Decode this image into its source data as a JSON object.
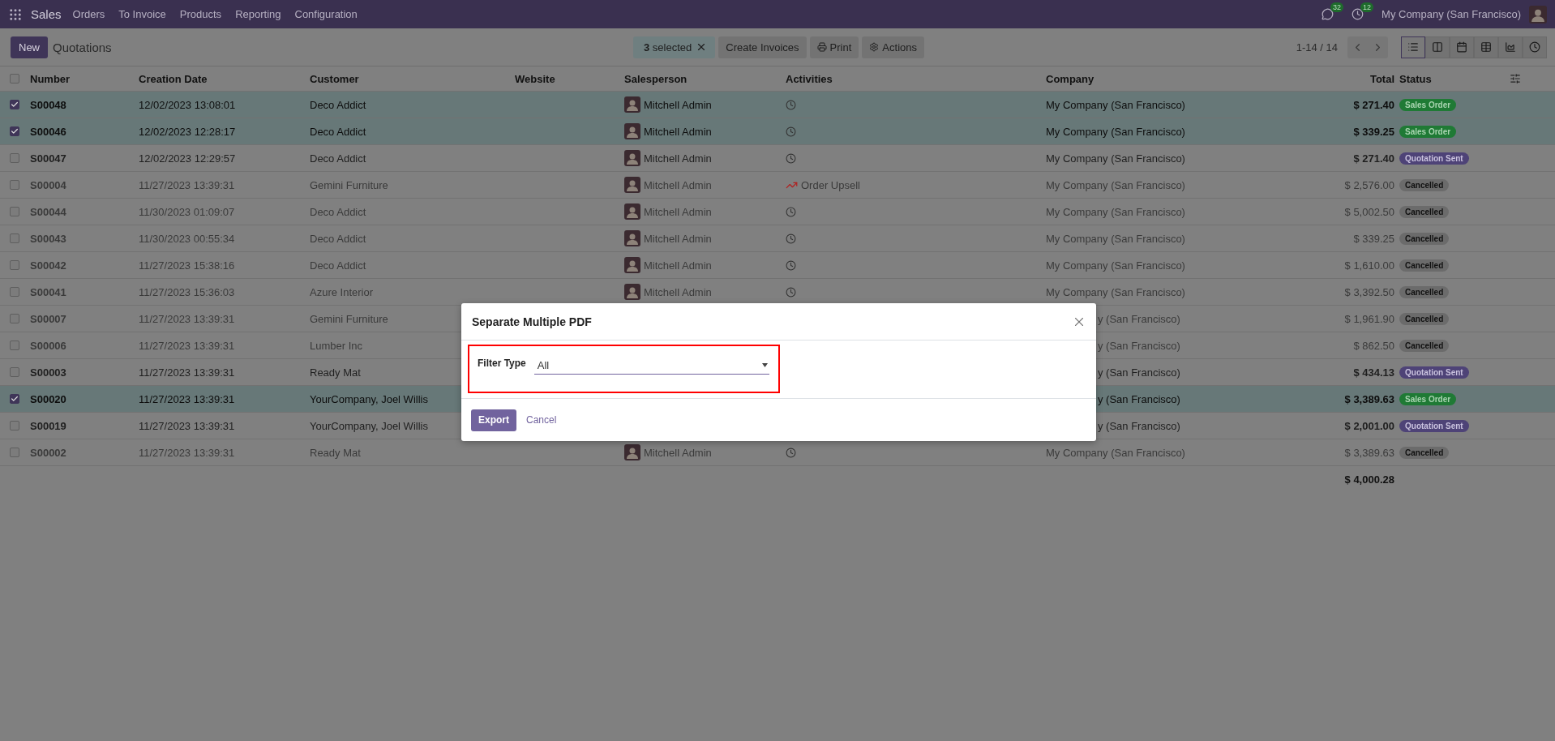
{
  "navbar": {
    "app": "Sales",
    "menu": [
      "Orders",
      "To Invoice",
      "Products",
      "Reporting",
      "Configuration"
    ],
    "messages_count": "32",
    "activities_count": "12",
    "company": "My Company (San Francisco)"
  },
  "control_panel": {
    "new_button": "New",
    "title": "Quotations",
    "selection": {
      "count": "3",
      "label": "selected"
    },
    "actions": [
      {
        "kind": "plain",
        "label": "Create Invoices"
      },
      {
        "kind": "print",
        "label": "Print"
      },
      {
        "kind": "gear",
        "label": "Actions"
      }
    ],
    "pager": "1-14 / 14",
    "views": [
      {
        "kind": "list",
        "selected": true
      },
      {
        "kind": "kanban",
        "selected": false
      },
      {
        "kind": "calendar",
        "selected": false
      },
      {
        "kind": "pivot",
        "selected": false
      },
      {
        "kind": "graph",
        "selected": false
      },
      {
        "kind": "activity",
        "selected": false
      }
    ]
  },
  "table": {
    "all_selected": false,
    "columns": [
      "Number",
      "Creation Date",
      "Customer",
      "Website",
      "Salesperson",
      "Activities",
      "Company",
      "Total",
      "Status"
    ],
    "rows": [
      {
        "number": "S00048",
        "date": "12/02/2023 13:08:01",
        "customer": "Deco Addict",
        "salesperson": "Mitchell Admin",
        "activity": {
          "kind": "clock"
        },
        "company": "My Company (San Francisco)",
        "total": "$ 271.40",
        "status": {
          "kind": "sale",
          "label": "Sales Order"
        },
        "selected": true
      },
      {
        "number": "S00046",
        "date": "12/02/2023 12:28:17",
        "customer": "Deco Addict",
        "salesperson": "Mitchell Admin",
        "activity": {
          "kind": "clock"
        },
        "company": "My Company (San Francisco)",
        "total": "$ 339.25",
        "status": {
          "kind": "sale",
          "label": "Sales Order"
        },
        "selected": true
      },
      {
        "number": "S00047",
        "date": "12/02/2023 12:29:57",
        "customer": "Deco Addict",
        "salesperson": "Mitchell Admin",
        "activity": {
          "kind": "clock"
        },
        "company": "My Company (San Francisco)",
        "total": "$ 271.40",
        "status": {
          "kind": "sent",
          "label": "Quotation Sent"
        },
        "selected": false
      },
      {
        "number": "S00004",
        "date": "11/27/2023 13:39:31",
        "customer": "Gemini Furniture",
        "salesperson": "Mitchell Admin",
        "activity": {
          "kind": "upsell",
          "label": "Order Upsell"
        },
        "company": "My Company (San Francisco)",
        "total": "$ 2,576.00",
        "status": {
          "kind": "cancel",
          "label": "Cancelled"
        },
        "selected": false
      },
      {
        "number": "S00044",
        "date": "11/30/2023 01:09:07",
        "customer": "Deco Addict",
        "salesperson": "Mitchell Admin",
        "activity": {
          "kind": "clock"
        },
        "company": "My Company (San Francisco)",
        "total": "$ 5,002.50",
        "status": {
          "kind": "cancel",
          "label": "Cancelled"
        },
        "selected": false
      },
      {
        "number": "S00043",
        "date": "11/30/2023 00:55:34",
        "customer": "Deco Addict",
        "salesperson": "Mitchell Admin",
        "activity": {
          "kind": "clock"
        },
        "company": "My Company (San Francisco)",
        "total": "$ 339.25",
        "status": {
          "kind": "cancel",
          "label": "Cancelled"
        },
        "selected": false
      },
      {
        "number": "S00042",
        "date": "11/27/2023 15:38:16",
        "customer": "Deco Addict",
        "salesperson": "Mitchell Admin",
        "activity": {
          "kind": "clock"
        },
        "company": "My Company (San Francisco)",
        "total": "$ 1,610.00",
        "status": {
          "kind": "cancel",
          "label": "Cancelled"
        },
        "selected": false
      },
      {
        "number": "S00041",
        "date": "11/27/2023 15:36:03",
        "customer": "Azure Interior",
        "salesperson": "Mitchell Admin",
        "activity": {
          "kind": "clock"
        },
        "company": "My Company (San Francisco)",
        "total": "$ 3,392.50",
        "status": {
          "kind": "cancel",
          "label": "Cancelled"
        },
        "selected": false
      },
      {
        "number": "S00007",
        "date": "11/27/2023 13:39:31",
        "customer": "Gemini Furniture",
        "company": "y (San Francisco)",
        "total": "$ 1,961.90",
        "status": {
          "kind": "cancel",
          "label": "Cancelled"
        },
        "selected": false
      },
      {
        "number": "S00006",
        "date": "11/27/2023 13:39:31",
        "customer": "Lumber Inc",
        "company": "y (San Francisco)",
        "total": "$ 862.50",
        "status": {
          "kind": "cancel",
          "label": "Cancelled"
        },
        "selected": false
      },
      {
        "number": "S00003",
        "date": "11/27/2023 13:39:31",
        "customer": "Ready Mat",
        "company": "y (San Francisco)",
        "total": "$ 434.13",
        "status": {
          "kind": "sent",
          "label": "Quotation Sent"
        },
        "selected": false
      },
      {
        "number": "S00020",
        "date": "11/27/2023 13:39:31",
        "customer": "YourCompany, Joel Willis",
        "company": "y (San Francisco)",
        "total": "$ 3,389.63",
        "status": {
          "kind": "sale",
          "label": "Sales Order"
        },
        "selected": true
      },
      {
        "number": "S00019",
        "date": "11/27/2023 13:39:31",
        "customer": "YourCompany, Joel Willis",
        "company": "y (San Francisco)",
        "total": "$ 2,001.00",
        "status": {
          "kind": "sent",
          "label": "Quotation Sent"
        },
        "selected": false
      },
      {
        "number": "S00002",
        "date": "11/27/2023 13:39:31",
        "customer": "Ready Mat",
        "salesperson": "Mitchell Admin",
        "activity": {
          "kind": "clock"
        },
        "company": "My Company (San Francisco)",
        "total": "$ 3,389.63",
        "status": {
          "kind": "cancel",
          "label": "Cancelled"
        },
        "selected": false
      }
    ],
    "grand_total": "$ 4,000.28"
  },
  "dialog": {
    "title": "Separate Multiple PDF",
    "field_label": "Filter Type",
    "field_value": "All",
    "buttons": [
      {
        "kind": "primary",
        "label": "Export"
      },
      {
        "kind": "link",
        "label": "Cancel"
      }
    ]
  }
}
